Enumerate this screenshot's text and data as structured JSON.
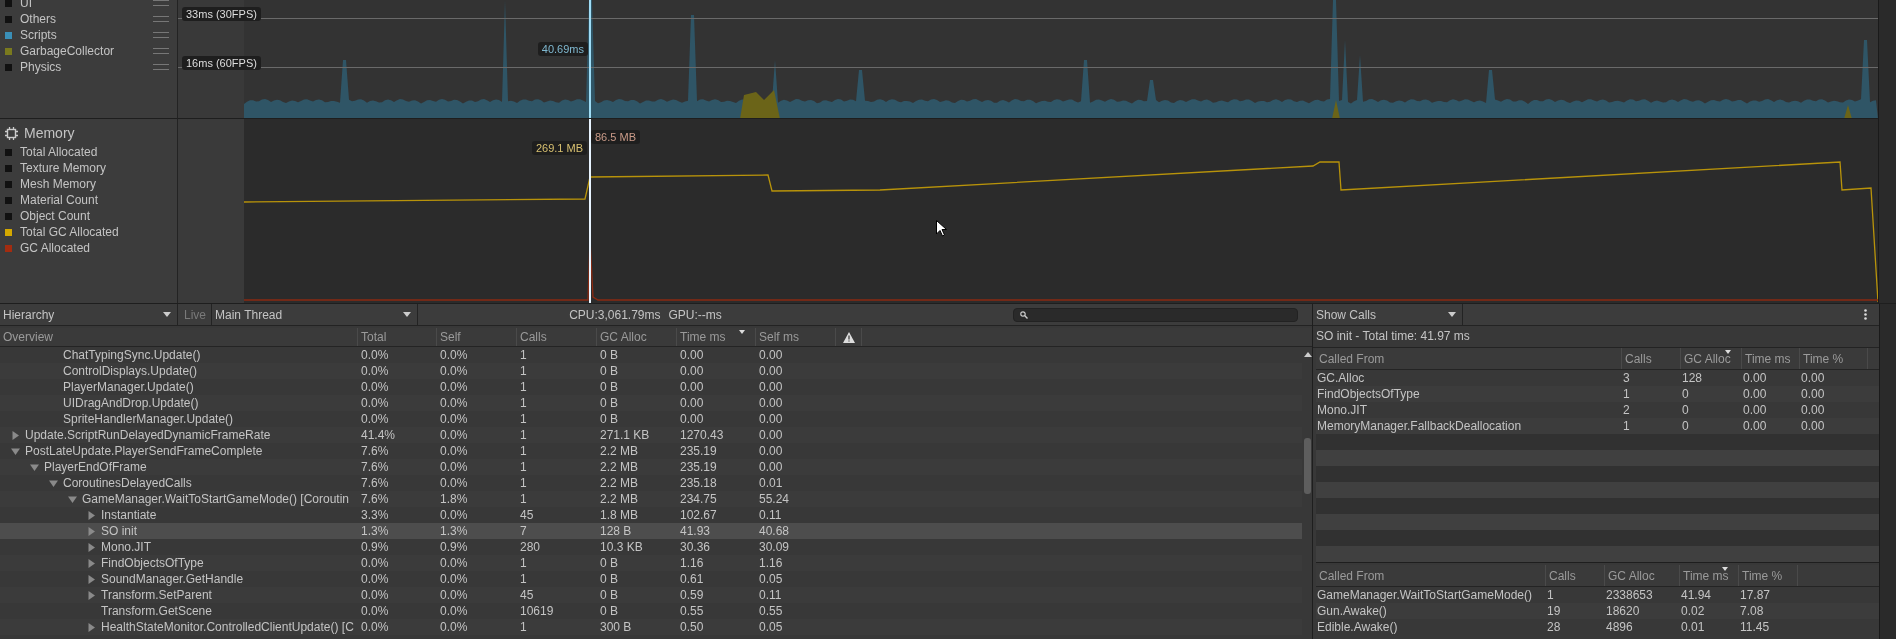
{
  "cpu_legend": [
    {
      "label": "UI",
      "color": "#111111"
    },
    {
      "label": "Others",
      "color": "#111111"
    },
    {
      "label": "Scripts",
      "color": "#3a8fb7"
    },
    {
      "label": "GarbageCollector",
      "color": "#7a7a1e"
    },
    {
      "label": "Physics",
      "color": "#111111"
    }
  ],
  "cpu_chart": {
    "fps_markers": [
      "33ms (30FPS)",
      "16ms (60FPS)"
    ],
    "selected_value": "40.69ms"
  },
  "memory_legend": {
    "title": "Memory",
    "items": [
      {
        "label": "Total Allocated",
        "color": "#111111"
      },
      {
        "label": "Texture Memory",
        "color": "#111111"
      },
      {
        "label": "Mesh Memory",
        "color": "#111111"
      },
      {
        "label": "Material Count",
        "color": "#111111"
      },
      {
        "label": "Object Count",
        "color": "#111111"
      },
      {
        "label": "Total GC Allocated",
        "color": "#d4a800"
      },
      {
        "label": "GC Allocated",
        "color": "#a32c10"
      }
    ]
  },
  "memory_chart": {
    "selected_values": [
      "269.1 MB",
      "86.5 MB"
    ]
  },
  "toolbar": {
    "view": "Hierarchy",
    "live": "Live",
    "thread": "Main Thread",
    "cpu": "CPU:3,061.79ms",
    "gpu": "GPU:--ms"
  },
  "hierarchy": {
    "columns": [
      {
        "label": "Overview",
        "sorted": false
      },
      {
        "label": "Total",
        "sorted": false
      },
      {
        "label": "Self",
        "sorted": false
      },
      {
        "label": "Calls",
        "sorted": false
      },
      {
        "label": "GC Alloc",
        "sorted": false
      },
      {
        "label": "Time ms",
        "sorted": true
      },
      {
        "label": "Self ms",
        "sorted": false
      }
    ],
    "continued_rows": [
      {
        "label": "ChatTypingSync.Update()",
        "selected": false,
        "cells": [
          "0.0%",
          "0.0%",
          "1",
          "0 B",
          "0.00",
          "0.00"
        ]
      },
      {
        "label": "ControlDisplays.Update()",
        "selected": false,
        "cells": [
          "0.0%",
          "0.0%",
          "1",
          "0 B",
          "0.00",
          "0.00"
        ]
      },
      {
        "label": "PlayerManager.Update()",
        "selected": false,
        "cells": [
          "0.0%",
          "0.0%",
          "1",
          "0 B",
          "0.00",
          "0.00"
        ]
      },
      {
        "label": "UIDragAndDrop.Update()",
        "selected": false,
        "cells": [
          "0.0%",
          "0.0%",
          "1",
          "0 B",
          "0.00",
          "0.00"
        ]
      },
      {
        "label": "SpriteHandlerManager.Update()",
        "selected": false,
        "cells": [
          "0.0%",
          "0.0%",
          "1",
          "0 B",
          "0.00",
          "0.00"
        ]
      }
    ],
    "nodes": [
      {
        "label": "Update.ScriptRunDelayedDynamicFrameRate",
        "selected": false,
        "expanded": false,
        "cells": [
          "41.4%",
          "0.0%",
          "1",
          "271.1 KB",
          "1270.43",
          "0.00"
        ]
      },
      {
        "label": "PostLateUpdate.PlayerSendFrameComplete",
        "selected": false,
        "expanded": true,
        "cells": [
          "7.6%",
          "0.0%",
          "1",
          "2.2 MB",
          "235.19",
          "0.00"
        ],
        "children": [
          {
            "label": "PlayerEndOfFrame",
            "selected": false,
            "expanded": true,
            "cells": [
              "7.6%",
              "0.0%",
              "1",
              "2.2 MB",
              "235.19",
              "0.00"
            ],
            "children": [
              {
                "label": "CoroutinesDelayedCalls",
                "selected": false,
                "expanded": true,
                "cells": [
                  "7.6%",
                  "0.0%",
                  "1",
                  "2.2 MB",
                  "235.18",
                  "0.01"
                ],
                "children": [
                  {
                    "label": "GameManager.WaitToStartGameMode() [Coroutin",
                    "selected": false,
                    "expanded": true,
                    "cells": [
                      "7.6%",
                      "1.8%",
                      "1",
                      "2.2 MB",
                      "234.75",
                      "55.24"
                    ],
                    "children": [
                      {
                        "label": "Instantiate",
                        "selected": false,
                        "expanded": false,
                        "cells": [
                          "3.3%",
                          "0.0%",
                          "45",
                          "1.8 MB",
                          "102.67",
                          "0.11"
                        ]
                      },
                      {
                        "label": "SO init",
                        "selected": true,
                        "expanded": false,
                        "cells": [
                          "1.3%",
                          "1.3%",
                          "7",
                          "128 B",
                          "41.93",
                          "40.68"
                        ]
                      },
                      {
                        "label": "Mono.JIT",
                        "selected": false,
                        "expanded": false,
                        "cells": [
                          "0.9%",
                          "0.9%",
                          "280",
                          "10.3 KB",
                          "30.36",
                          "30.09"
                        ]
                      },
                      {
                        "label": "FindObjectsOfType",
                        "selected": false,
                        "expanded": false,
                        "cells": [
                          "0.0%",
                          "0.0%",
                          "1",
                          "0 B",
                          "1.16",
                          "1.16"
                        ]
                      },
                      {
                        "label": "SoundManager.GetHandle",
                        "selected": false,
                        "expanded": false,
                        "cells": [
                          "0.0%",
                          "0.0%",
                          "1",
                          "0 B",
                          "0.61",
                          "0.05"
                        ]
                      },
                      {
                        "label": "Transform.SetParent",
                        "selected": false,
                        "expanded": false,
                        "cells": [
                          "0.0%",
                          "0.0%",
                          "45",
                          "0 B",
                          "0.59",
                          "0.11"
                        ]
                      },
                      {
                        "label": "Transform.GetScene",
                        "selected": false,
                        "cells": [
                          "0.0%",
                          "0.0%",
                          "10619",
                          "0 B",
                          "0.55",
                          "0.55"
                        ]
                      },
                      {
                        "label": "HealthStateMonitor.ControlledClientUpdate() [C",
                        "selected": false,
                        "expanded": false,
                        "cells": [
                          "0.0%",
                          "0.0%",
                          "1",
                          "300 B",
                          "0.50",
                          "0.05"
                        ]
                      }
                    ]
                  }
                ]
              }
            ]
          }
        ]
      }
    ]
  },
  "details": {
    "mode": "Show Calls",
    "summary": "SO init - Total time: 41.97 ms",
    "callees": {
      "columns": [
        {
          "label": "Called From",
          "sorted": false
        },
        {
          "label": "Calls",
          "sorted": false
        },
        {
          "label": "GC Alloc",
          "sorted": true
        },
        {
          "label": "Time ms",
          "sorted": false
        },
        {
          "label": "Time %",
          "sorted": false
        }
      ],
      "rows": [
        [
          "GC.Alloc",
          "3",
          "128",
          "0.00",
          "0.00"
        ],
        [
          "FindObjectsOfType",
          "1",
          "0",
          "0.00",
          "0.00"
        ],
        [
          "Mono.JIT",
          "2",
          "0",
          "0.00",
          "0.00"
        ],
        [
          "MemoryManager.FallbackDeallocation",
          "1",
          "0",
          "0.00",
          "0.00"
        ]
      ]
    },
    "callers": {
      "columns": [
        {
          "label": "Called From",
          "sorted": false
        },
        {
          "label": "Calls",
          "sorted": false
        },
        {
          "label": "GC Alloc",
          "sorted": false
        },
        {
          "label": "Time ms",
          "sorted": true
        },
        {
          "label": "Time %",
          "sorted": false
        }
      ],
      "rows": [
        [
          "GameManager.WaitToStartGameMode()",
          "1",
          "2338653",
          "41.94",
          "17.87"
        ],
        [
          "Gun.Awake()",
          "19",
          "18620",
          "0.02",
          "7.08"
        ],
        [
          "Edible.Awake()",
          "28",
          "4896",
          "0.01",
          "11.45"
        ]
      ]
    }
  }
}
